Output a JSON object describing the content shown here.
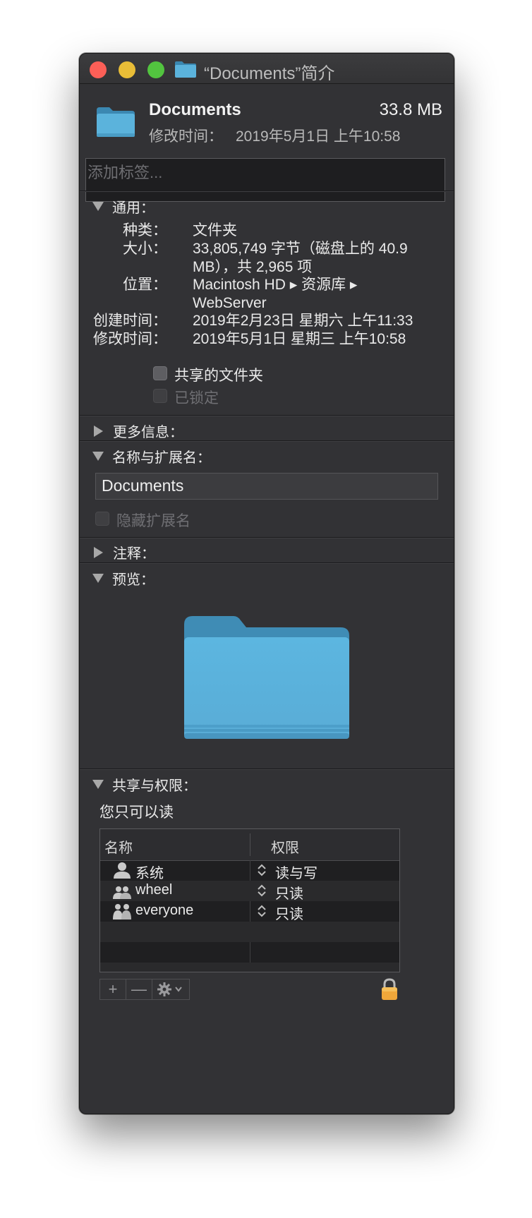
{
  "window": {
    "title": "“Documents”简介"
  },
  "header": {
    "name": "Documents",
    "size": "33.8 MB",
    "modified_label": "修改时间：",
    "modified_value": "2019年5月1日 上午10:58"
  },
  "tags": {
    "placeholder": "添加标签..."
  },
  "general": {
    "heading": "通用：",
    "kind_label": "种类：",
    "kind_value": "文件夹",
    "size_label": "大小：",
    "size_value_line1": "33,805,749 字节（磁盘上的 40.9",
    "size_value_line2": "MB），共 2,965 项",
    "where_label": "位置：",
    "where_value_line1": "Macintosh HD ▸ 资源库 ▸",
    "where_value_line2": "WebServer",
    "created_label": "创建时间：",
    "created_value": "2019年2月23日 星期六 上午11:33",
    "modified_label": "修改时间：",
    "modified_value": "2019年5月1日 星期三 上午10:58",
    "shared_folder_label": "共享的文件夹",
    "shared_folder_checked": false,
    "locked_label": "已锁定",
    "locked_checked": false
  },
  "more_info": {
    "heading": "更多信息："
  },
  "name_ext": {
    "heading": "名称与扩展名：",
    "value": "Documents",
    "hide_ext_label": "隐藏扩展名",
    "hide_ext_checked": false
  },
  "comments": {
    "heading": "注释："
  },
  "preview": {
    "heading": "预览："
  },
  "sharing": {
    "heading": "共享与权限：",
    "note": "您只可以读",
    "columns": [
      "名称",
      "权限"
    ],
    "rows": [
      {
        "name": "系统",
        "privilege": "读与写",
        "icon": "single-user-icon"
      },
      {
        "name": "wheel",
        "privilege": "只读",
        "icon": "group-icon"
      },
      {
        "name": "everyone",
        "privilege": "只读",
        "icon": "everyone-icon"
      }
    ],
    "toolbar": {
      "add": "+",
      "remove": "—"
    }
  },
  "colors": {
    "window_bg": "#323235",
    "folder_blue": "#5ab4de",
    "lock_orange": "#f0a73a"
  }
}
